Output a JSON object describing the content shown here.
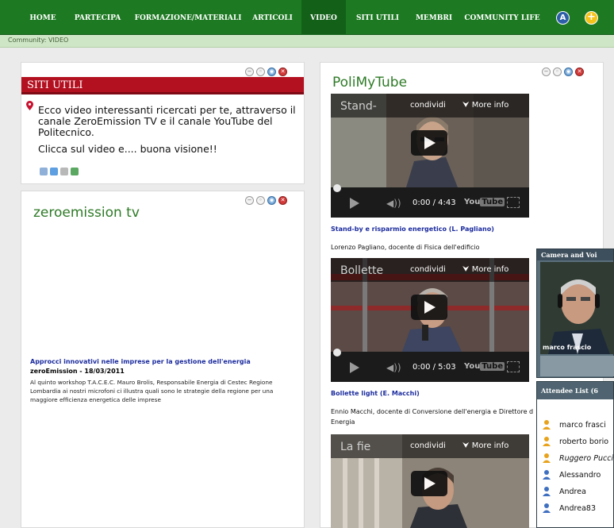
{
  "nav": {
    "items": [
      "HOME",
      "PARTECIPA",
      "FORMAZIONE/MATERIALI",
      "ARTICOLI",
      "VIDEO",
      "SITI UTILI",
      "MEMBRI",
      "COMMUNITY LIFE"
    ],
    "active": "VIDEO",
    "accessibility_glyph": "A",
    "add_glyph": "+"
  },
  "breadcrumb": "Community: VIDEO",
  "panel_controls": [
    "−",
    "◦",
    "◉",
    "✕"
  ],
  "siti_utili": {
    "banner": "SITI UTILI",
    "intro": "Ecco video interessanti ricercati per te, attraverso il canale ZeroEmission TV e il canale YouTube del Politecnico.",
    "call_to_action": "Clicca sul video e.... buona visione!!",
    "icons": [
      "rss-icon",
      "share-icon",
      "settings-icon",
      "edit-icon"
    ]
  },
  "zeroemission": {
    "title": "zeroemission tv",
    "article_title": "Approcci innovativi nelle imprese per la gestione dell'energia",
    "article_date": "zeroEmission - 18/03/2011",
    "article_body": "Al quinto workshop T.A.C.E.C. Mauro Brolis, Responsabile Energia di Cestec Regione Lombardia ai nostri microfoni ci illustra quali sono le strategie della regione per una maggiore efficienza energetica delle imprese"
  },
  "polimytube": {
    "title": "PoliMyTube",
    "share_label": "condividi",
    "more_info_label": "More info",
    "youtube_label": "You",
    "youtube_label_box": "Tube",
    "videos": [
      {
        "thumb_title": "Stand-",
        "time": "0:00 / 4:43",
        "link": "Stand-by e risparmio energetico (L. Pagliano)",
        "desc": "Lorenzo Pagliano, docente di Fisica dell'edificio"
      },
      {
        "thumb_title": "Bollette",
        "time": "0:00 / 5:03",
        "link": "Bollette light (E. Macchi)",
        "desc": "Ennio Macchi, docente di Conversione dell'energia e Direttore d",
        "desc2": "Energia"
      },
      {
        "thumb_title": "La fie",
        "time": "",
        "link": "",
        "desc": ""
      }
    ]
  },
  "camera": {
    "header": "Camera and Voi",
    "speaker": "marco frascio"
  },
  "attendees": {
    "header": "Attendee List (6",
    "list": [
      {
        "name": "marco frasci",
        "role": "host"
      },
      {
        "name": "roberto borio",
        "role": "host"
      },
      {
        "name": "Ruggero Pucci",
        "role": "host-italic"
      },
      {
        "name": "Alessandro",
        "role": "participant"
      },
      {
        "name": "Andrea",
        "role": "participant"
      },
      {
        "name": "Andrea83",
        "role": "participant"
      }
    ]
  },
  "colors": {
    "nav_bg": "#1d7a22",
    "banner_red": "#b31020",
    "title_green": "#2d7a26",
    "link_blue": "#1c2c9e"
  }
}
